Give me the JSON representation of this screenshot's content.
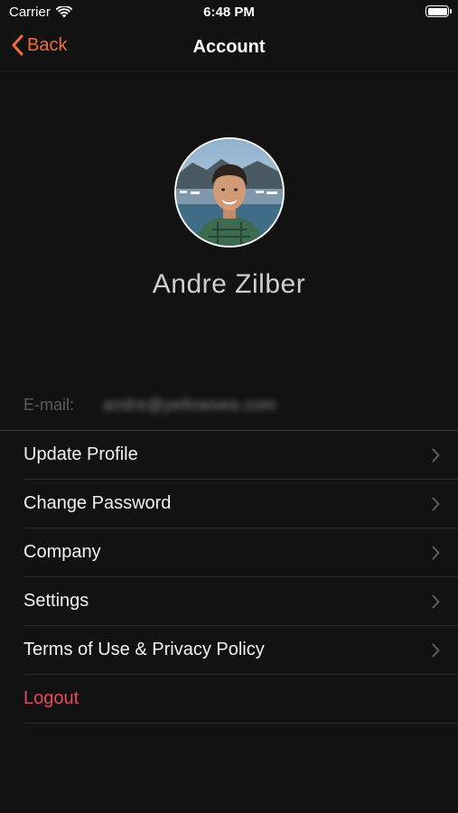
{
  "status_bar": {
    "carrier": "Carrier",
    "time": "6:48 PM",
    "icons": [
      "wifi-icon",
      "battery-icon"
    ]
  },
  "nav": {
    "back_label": "Back",
    "title": "Account",
    "accent_color": "#f26d3d"
  },
  "profile": {
    "name": "Andre Zilber",
    "avatar": "profile-photo"
  },
  "email": {
    "label": "E-mail:",
    "value": "andre@yellowsea.com"
  },
  "menu": {
    "items": [
      {
        "label": "Update Profile",
        "icon": "chevron-right-icon"
      },
      {
        "label": "Change Password",
        "icon": "chevron-right-icon"
      },
      {
        "label": "Company",
        "icon": "chevron-right-icon"
      },
      {
        "label": "Settings",
        "icon": "chevron-right-icon"
      },
      {
        "label": "Terms of Use & Privacy Policy",
        "icon": "chevron-right-icon"
      }
    ],
    "logout_label": "Logout",
    "logout_color": "#e5485f"
  }
}
